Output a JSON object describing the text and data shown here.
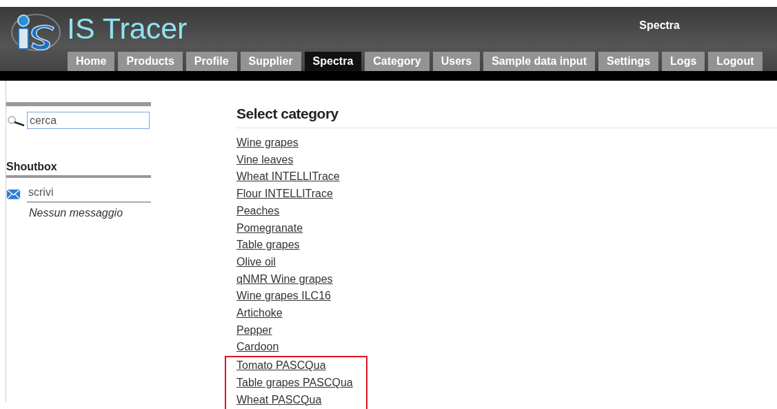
{
  "header": {
    "title": "IS Tracer",
    "page_name": "Spectra"
  },
  "tabs": [
    {
      "label": "Home",
      "selected": false
    },
    {
      "label": "Products",
      "selected": false
    },
    {
      "label": "Profile",
      "selected": false
    },
    {
      "label": "Supplier",
      "selected": false
    },
    {
      "label": "Spectra",
      "selected": true
    },
    {
      "label": "Category",
      "selected": false
    },
    {
      "label": "Users",
      "selected": false
    },
    {
      "label": "Sample data input",
      "selected": false
    },
    {
      "label": "Settings",
      "selected": false
    },
    {
      "label": "Logs",
      "selected": false
    },
    {
      "label": "Logout",
      "selected": false
    }
  ],
  "sidebar": {
    "search": {
      "placeholder": "cerca"
    },
    "shoutbox": {
      "title": "Shoutbox",
      "input_placeholder": "scrivi",
      "empty_text": "Nessun messaggio"
    }
  },
  "main": {
    "heading": "Select category",
    "categories": [
      "Wine grapes",
      "Vine leaves",
      "Wheat INTELLITrace",
      "Flour INTELLITrace",
      "Peaches",
      "Pomegranate",
      "Table grapes",
      "Olive oil",
      "qNMR Wine grapes",
      "Wine grapes ILC16",
      "Artichoke",
      "Pepper",
      "Cardoon"
    ],
    "highlighted_categories": [
      "Tomato PASCQua",
      "Table grapes PASCQua",
      "Wheat PASCQua"
    ]
  }
}
